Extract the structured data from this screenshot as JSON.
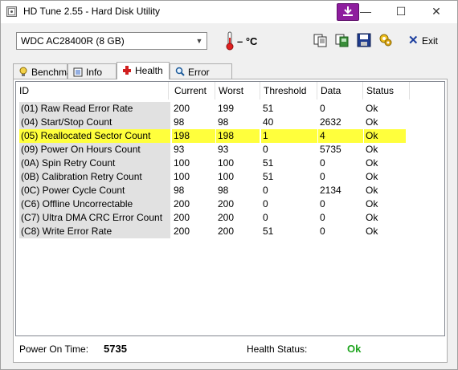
{
  "window": {
    "title": "HD Tune 2.55 - Hard Disk Utility",
    "minimize_glyph": "—",
    "maximize_glyph": "☐",
    "close_glyph": "✕"
  },
  "toolbar": {
    "drive": "WDC AC28400R (8 GB)",
    "temperature": "– °C",
    "exit_label": "Exit",
    "icons": [
      "copy-info-icon",
      "copy-screenshot-icon",
      "save-icon",
      "options-icon"
    ]
  },
  "tabs": [
    {
      "label": "Benchmark",
      "icon": "benchmark-icon"
    },
    {
      "label": "Info",
      "icon": "info-icon"
    },
    {
      "label": "Health",
      "icon": "health-icon",
      "active": true
    },
    {
      "label": "Error Scan",
      "icon": "error-scan-icon"
    }
  ],
  "table": {
    "columns": [
      "ID",
      "Current",
      "Worst",
      "Threshold",
      "Data",
      "Status"
    ],
    "rows": [
      [
        "(01) Raw Read Error Rate",
        "200",
        "199",
        "51",
        "0",
        "Ok"
      ],
      [
        "(04) Start/Stop Count",
        "98",
        "98",
        "40",
        "2632",
        "Ok"
      ],
      [
        "(05) Reallocated Sector Count",
        "198",
        "198",
        "1",
        "4",
        "Ok"
      ],
      [
        "(09) Power On Hours Count",
        "93",
        "93",
        "0",
        "5735",
        "Ok"
      ],
      [
        "(0A) Spin Retry Count",
        "100",
        "100",
        "51",
        "0",
        "Ok"
      ],
      [
        "(0B) Calibration Retry Count",
        "100",
        "100",
        "51",
        "0",
        "Ok"
      ],
      [
        "(0C) Power Cycle Count",
        "98",
        "98",
        "0",
        "2134",
        "Ok"
      ],
      [
        "(C6) Offline Uncorrectable",
        "200",
        "200",
        "0",
        "0",
        "Ok"
      ],
      [
        "(C7) Ultra DMA CRC Error Count",
        "200",
        "200",
        "0",
        "0",
        "Ok"
      ],
      [
        "(C8) Write Error Rate",
        "200",
        "200",
        "51",
        "0",
        "Ok"
      ]
    ],
    "highlighted_row": 2,
    "highlight_color": "#ffff3c"
  },
  "footer": {
    "power_on_label": "Power On Time:",
    "power_on_value": "5735",
    "health_label": "Health Status:",
    "health_value": "Ok",
    "health_color": "#1fa51f"
  }
}
